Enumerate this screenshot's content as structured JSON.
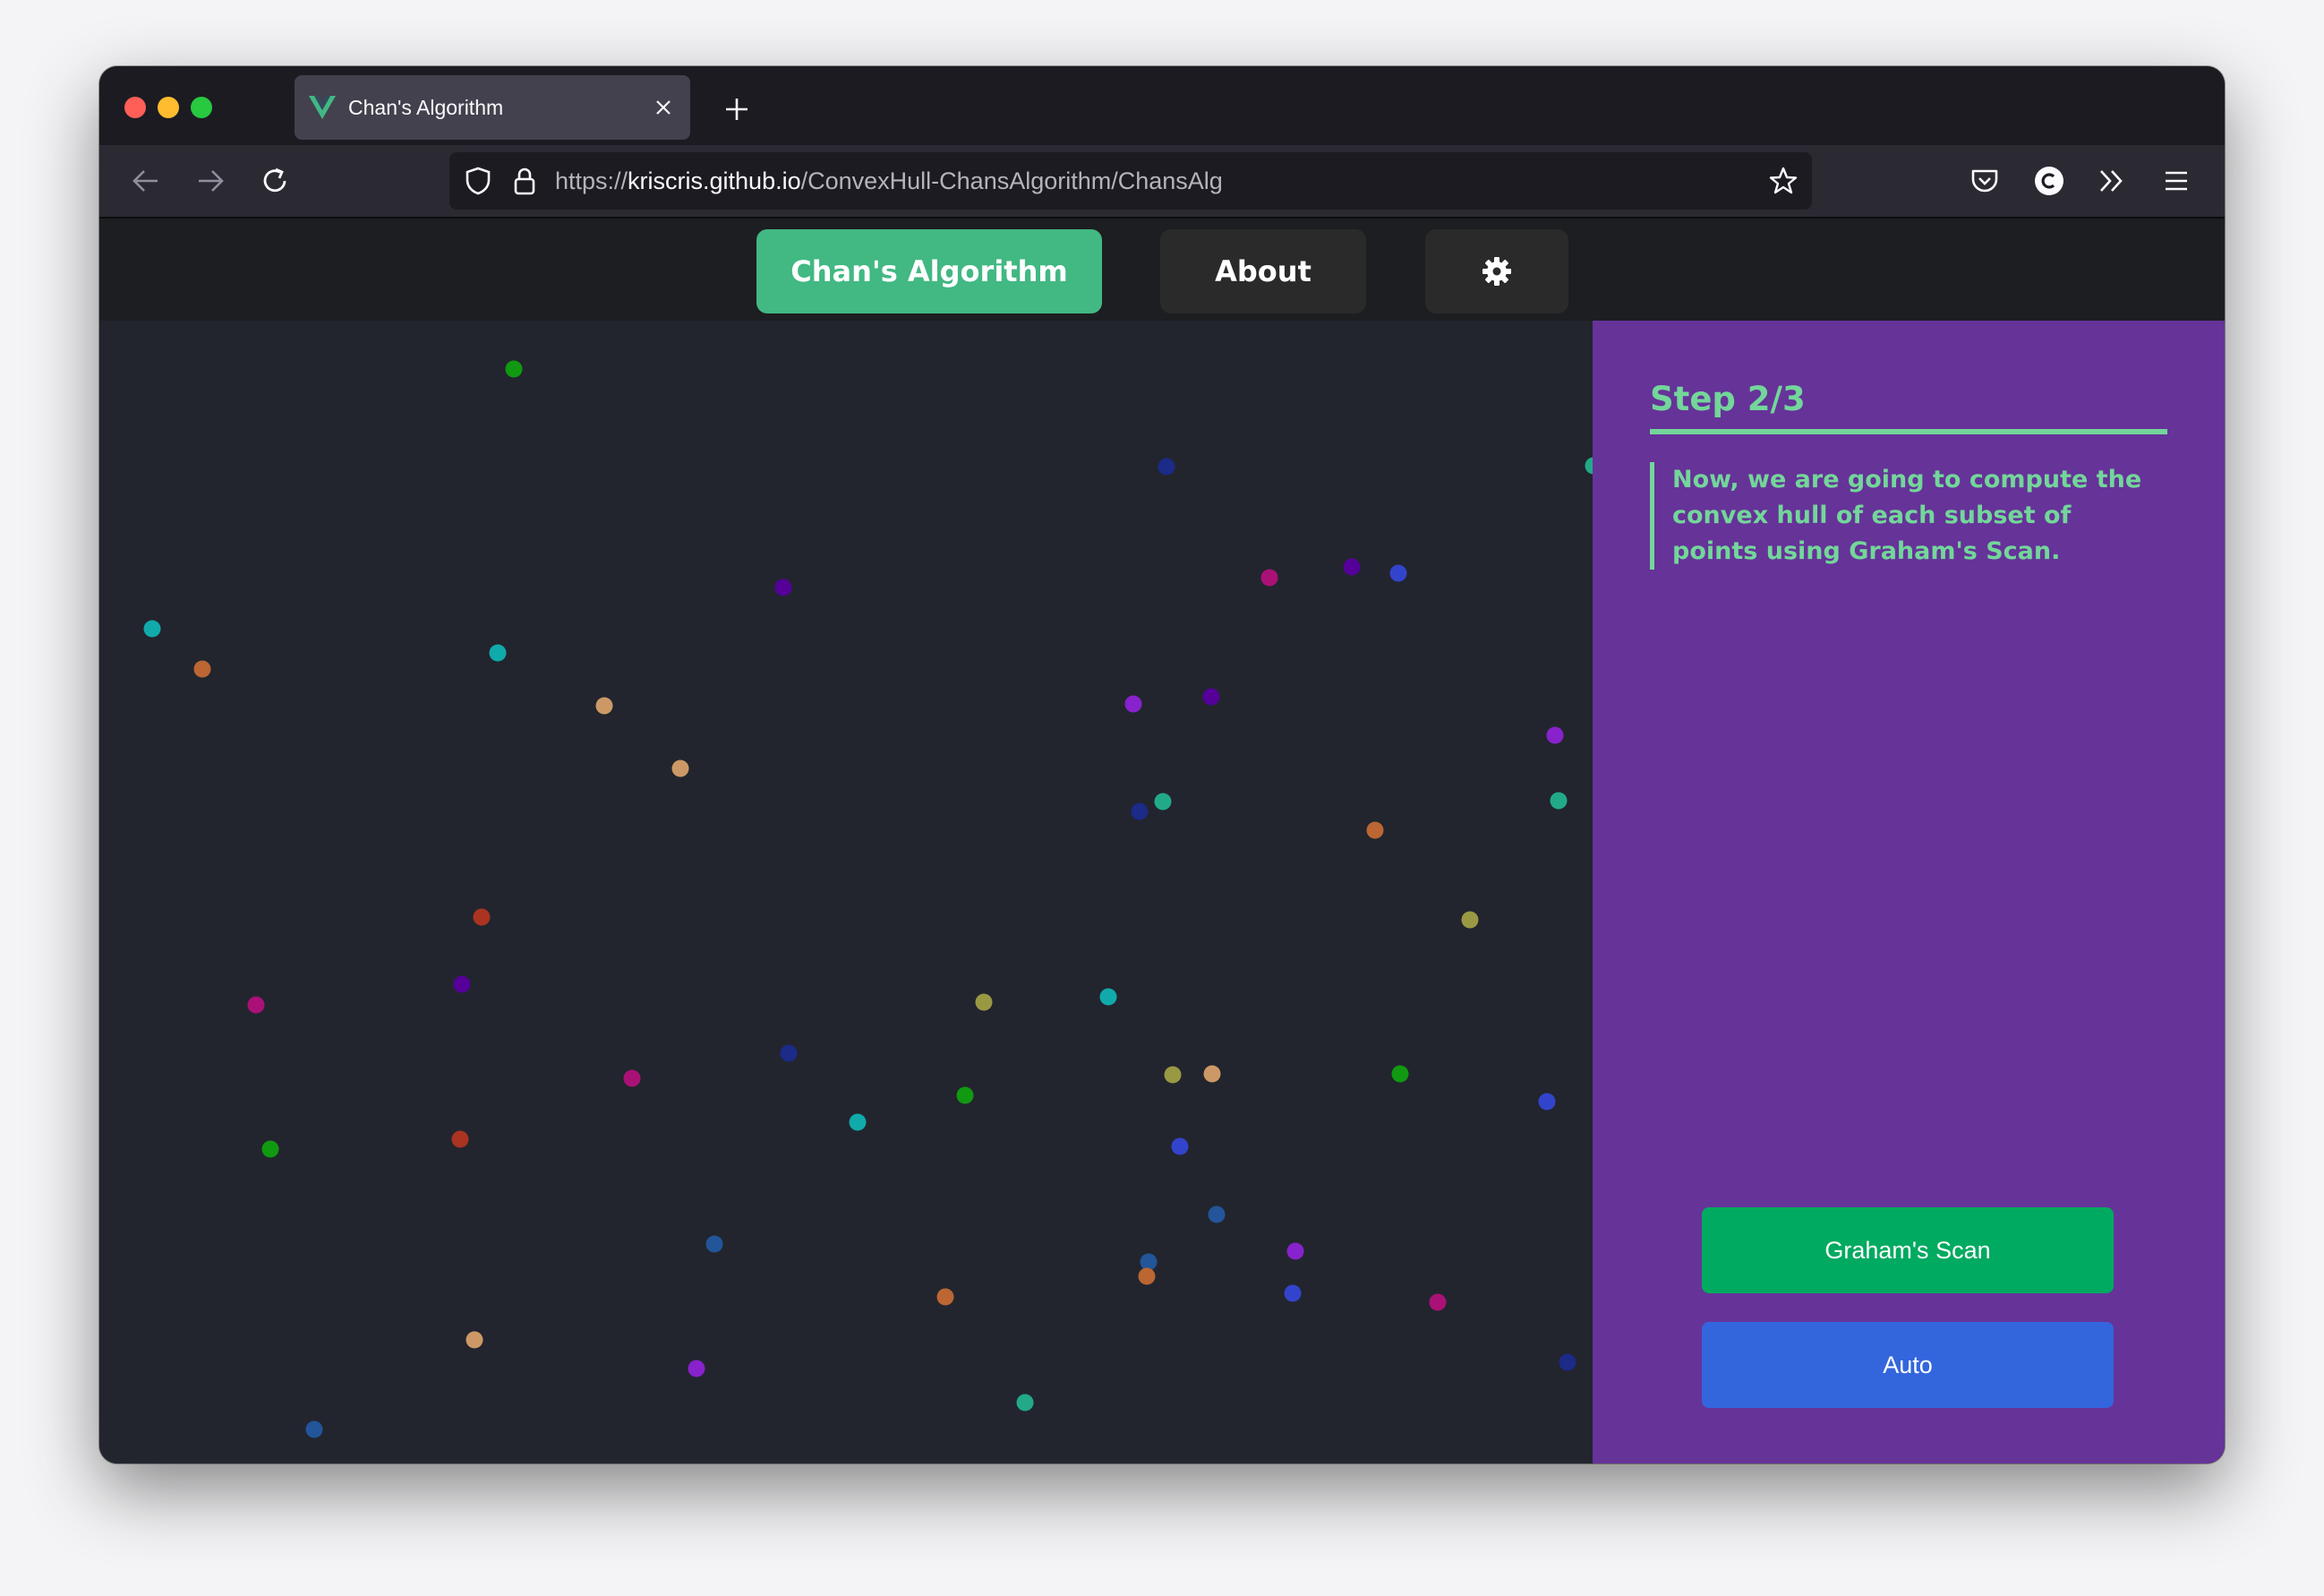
{
  "browser": {
    "tab_title": "Chan's Algorithm",
    "url_scheme": "https://",
    "url_host": "kriscris.github.io",
    "url_path": "/ConvexHull-ChansAlgorithm/ChansAlg"
  },
  "header": {
    "nav": [
      {
        "label": "Chan's Algorithm",
        "active": true
      },
      {
        "label": "About",
        "active": false
      }
    ],
    "settings_icon": "gear-icon"
  },
  "sidebar": {
    "step_title": "Step 2/3",
    "description": "Now, we are going to compute the convex hull of each subset of points using Graham's Scan.",
    "buttons": [
      {
        "label": "Graham's Scan",
        "color": "#00aa60"
      },
      {
        "label": "Auto",
        "color": "#3366dd"
      }
    ]
  },
  "colors": {
    "accent": "#42b883",
    "sidebar_bg": "#663399",
    "canvas_bg": "#22252e",
    "step_text": "#73d69a"
  },
  "points_note_colors": [
    "#119911",
    "#1c2a88",
    "#22aa88",
    "#880088",
    "#550099",
    "#3344cc",
    "#11aaaa",
    "#bb6633",
    "#cc9966",
    "#aa3322",
    "#9999ee",
    "#8822cc",
    "#aa2266",
    "#999944",
    "#225599"
  ]
}
